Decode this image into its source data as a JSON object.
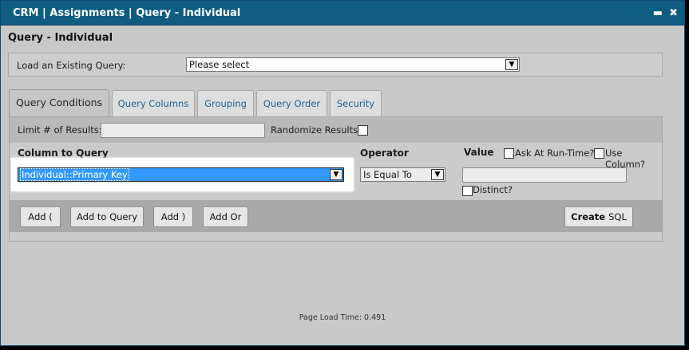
{
  "window": {
    "title": "CRM | Assignments | Query - Individual",
    "minimize_glyph": "▬",
    "close_glyph": "✖"
  },
  "page": {
    "title": "Query - Individual"
  },
  "load_query": {
    "label": "Load an Existing Query:",
    "selected": "Please select"
  },
  "tabs": [
    {
      "label": "Query Conditions",
      "active": true
    },
    {
      "label": "Query Columns"
    },
    {
      "label": "Grouping"
    },
    {
      "label": "Query Order"
    },
    {
      "label": "Security"
    }
  ],
  "conditions": {
    "limit_label": "Limit # of Results:",
    "limit_value": "",
    "randomize_label": "Randomize Results?",
    "column_header": "Column to Query",
    "column_selected": "Individual::Primary Key",
    "operator_header": "Operator",
    "operator_selected": "Is Equal To",
    "value_header": "Value",
    "ask_runtime_label": "Ask At Run-Time?",
    "use_column_label": "Use Column?",
    "value_input": "",
    "distinct_label": "Distinct?"
  },
  "buttons": {
    "add_paren": "Add (",
    "add_to_query": "Add to Query",
    "add_close_paren": "Add )",
    "add_or": "Add Or",
    "create": "Create",
    "sql": "SQL"
  },
  "footer": {
    "load_time": "Page Load Time: 0.491"
  },
  "colors": {
    "titlebar": "#0e5c82",
    "tab_link": "#1f5f8c",
    "selection": "#3399ff"
  },
  "icons": {
    "dropdown": "chevron-down-icon"
  }
}
